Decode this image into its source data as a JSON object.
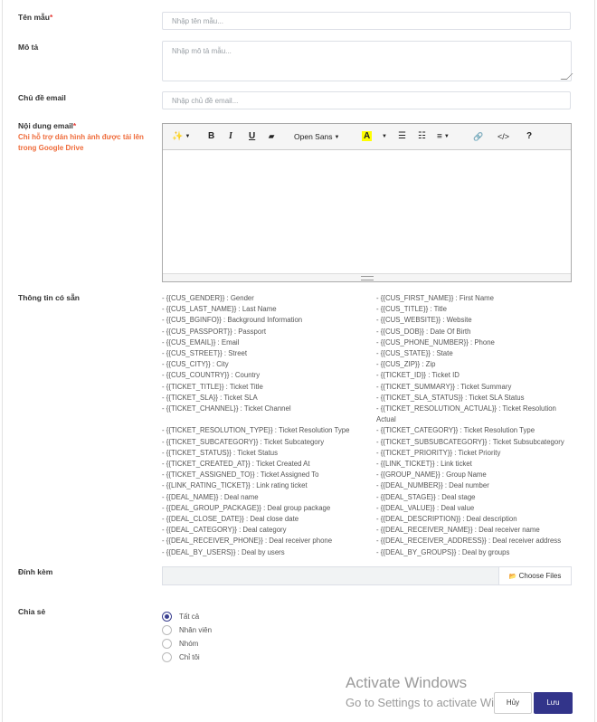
{
  "form": {
    "template_name_label": "Tên mẫu",
    "template_name_placeholder": "Nhập tên mẫu...",
    "description_label": "Mô tả",
    "description_placeholder": "Nhập mô tả mẫu...",
    "subject_label": "Chủ đề email",
    "subject_placeholder": "Nhập chủ đề email...",
    "content_label": "Nội dung email",
    "content_hint": "Chỉ hỗ trợ dán hình ảnh được tải lên trong Google Drive",
    "required_mark": "*",
    "variables_label": "Thông tin có sẵn",
    "attachment_label": "Đính kèm",
    "choose_files": "Choose Files",
    "share_label": "Chia sẻ"
  },
  "toolbar": {
    "magic": "✨",
    "bold": "B",
    "italic": "I",
    "underline": "U",
    "eraser": "▰",
    "font": "Open Sans",
    "color": "A",
    "caret": "▼",
    "ul": "☰",
    "ol": "☷",
    "align": "≡",
    "link": "🔗",
    "code": "</>",
    "help": "?"
  },
  "variables_left": [
    "- {{CUS_GENDER}} : Gender",
    "- {{CUS_LAST_NAME}} : Last Name",
    "- {{CUS_BGINFO}} : Background Information",
    "- {{CUS_PASSPORT}} : Passport",
    "- {{CUS_EMAIL}} : Email",
    "- {{CUS_STREET}} : Street",
    "- {{CUS_CITY}} : City",
    "- {{CUS_COUNTRY}} : Country",
    "- {{TICKET_TITLE}} : Ticket Title",
    "- {{TICKET_SLA}} : Ticket SLA",
    "- {{TICKET_CHANNEL}} : Ticket Channel",
    "",
    "- {{TICKET_RESOLUTION_TYPE}} : Ticket Resolution Type",
    "- {{TICKET_SUBCATEGORY}} : Ticket Subcategory",
    "- {{TICKET_STATUS}} : Ticket Status",
    "- {{TICKET_CREATED_AT}} : Ticket Created At",
    "- {{TICKET_ASSIGNED_TO}} : Ticket Assigned To",
    "- {{LINK_RATING_TICKET}} : Link rating ticket",
    "- {{DEAL_NAME}} : Deal name",
    "- {{DEAL_GROUP_PACKAGE}} : Deal group package",
    "- {{DEAL_CLOSE_DATE}} : Deal close date",
    "- {{DEAL_CATEGORY}} : Deal category",
    "- {{DEAL_RECEIVER_PHONE}} : Deal receiver phone",
    "- {{DEAL_BY_USERS}} : Deal by users"
  ],
  "variables_right": [
    "- {{CUS_FIRST_NAME}} : First Name",
    "- {{CUS_TITLE}} : Title",
    "- {{CUS_WEBSITE}} : Website",
    "- {{CUS_DOB}} : Date Of Birth",
    "- {{CUS_PHONE_NUMBER}} : Phone",
    "- {{CUS_STATE}} : State",
    "- {{CUS_ZIP}} : Zip",
    "- {{TICKET_ID}} : Ticket ID",
    "- {{TICKET_SUMMARY}} : Ticket Summary",
    "- {{TICKET_SLA_STATUS}} : Ticket SLA Status",
    "- {{TICKET_RESOLUTION_ACTUAL}} : Ticket Resolution Actual",
    "- {{TICKET_CATEGORY}} : Ticket Resolution Type",
    "- {{TICKET_SUBSUBCATEGORY}} : Ticket Subsubcategory",
    "- {{TICKET_PRIORITY}} : Ticket Priority",
    "- {{LINK_TICKET}} : Link ticket",
    "- {{GROUP_NAME}} : Group Name",
    "- {{DEAL_NUMBER}} : Deal number",
    "- {{DEAL_STAGE}} : Deal stage",
    "- {{DEAL_VALUE}} : Deal value",
    "- {{DEAL_DESCRIPTION}} : Deal description",
    "- {{DEAL_RECEIVER_NAME}} : Deal receiver name",
    "- {{DEAL_RECEIVER_ADDRESS}} : Deal receiver address",
    "- {{DEAL_BY_GROUPS}} : Deal by groups"
  ],
  "share_options": [
    {
      "label": "Tất cả",
      "selected": true
    },
    {
      "label": "Nhân viên",
      "selected": false
    },
    {
      "label": "Nhóm",
      "selected": false
    },
    {
      "label": "Chỉ tôi",
      "selected": false
    }
  ],
  "watermark": {
    "title": "Activate Windows",
    "subtitle": "Go to Settings to activate Windows."
  },
  "buttons": {
    "cancel": "Hủy",
    "save": "Lưu"
  },
  "colors": {
    "accent": "#32348a",
    "hint": "#ef6c3b",
    "required": "#e53935"
  }
}
